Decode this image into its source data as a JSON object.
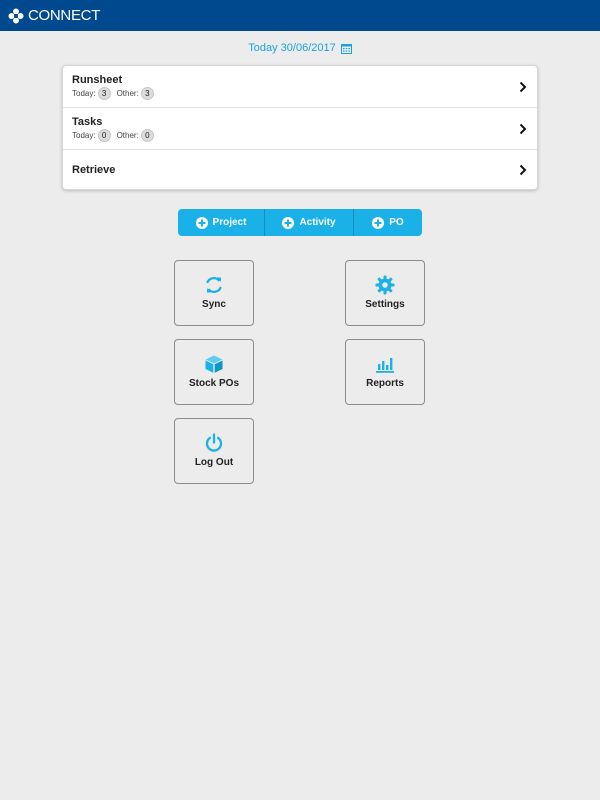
{
  "app": {
    "title": "CONNECT"
  },
  "date": {
    "label": "Today 30/06/2017"
  },
  "list": {
    "items": [
      {
        "title": "Runsheet",
        "today_label": "Today:",
        "today_count": "3",
        "other_label": "Other:",
        "other_count": "3"
      },
      {
        "title": "Tasks",
        "today_label": "Today:",
        "today_count": "0",
        "other_label": "Other:",
        "other_count": "0"
      },
      {
        "title": "Retrieve"
      }
    ]
  },
  "actions": {
    "project": "Project",
    "activity": "Activity",
    "po": "PO"
  },
  "tiles": {
    "sync": "Sync",
    "settings": "Settings",
    "stock_pos": "Stock POs",
    "reports": "Reports",
    "logout": "Log Out"
  },
  "colors": {
    "header": "#00498f",
    "accent": "#1ab0e8",
    "background": "#ececec"
  }
}
